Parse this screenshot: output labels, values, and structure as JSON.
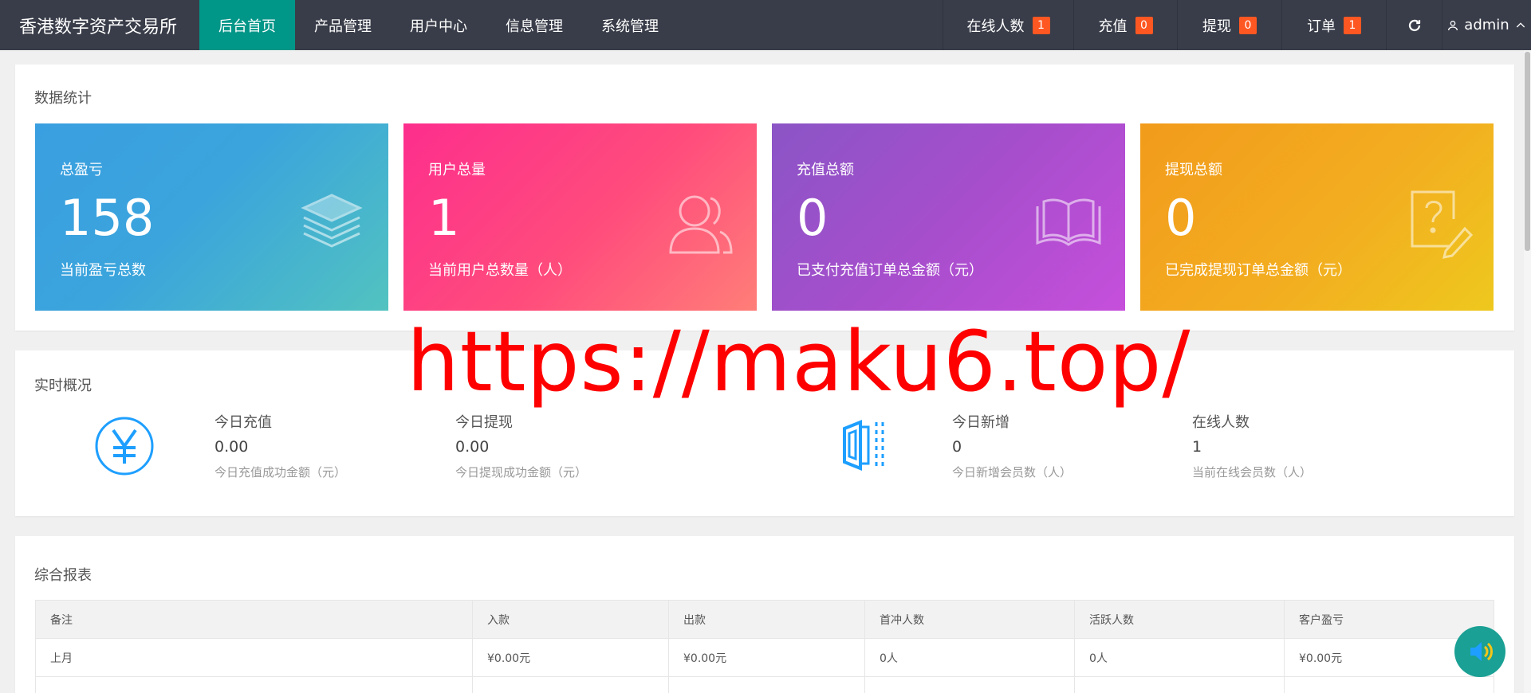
{
  "header": {
    "brand": "香港数字资产交易所",
    "nav": [
      {
        "label": "后台首页",
        "active": true
      },
      {
        "label": "产品管理"
      },
      {
        "label": "用户中心"
      },
      {
        "label": "信息管理"
      },
      {
        "label": "系统管理"
      }
    ],
    "right": {
      "online": {
        "label": "在线人数",
        "count": "1"
      },
      "recharge": {
        "label": "充值",
        "count": "0"
      },
      "withdraw": {
        "label": "提现",
        "count": "0"
      },
      "orders": {
        "label": "订单",
        "count": "1"
      },
      "refresh_icon": "refresh-icon",
      "user": "admin"
    }
  },
  "stats": {
    "title": "数据统计",
    "cards": [
      {
        "label": "总盈亏",
        "value": "158",
        "desc": "当前盈亏总数",
        "icon": "layers-icon"
      },
      {
        "label": "用户总量",
        "value": "1",
        "desc": "当前用户总数量（人）",
        "icon": "users-icon"
      },
      {
        "label": "充值总额",
        "value": "0",
        "desc": "已支付充值订单总金额（元）",
        "icon": "book-icon"
      },
      {
        "label": "提现总额",
        "value": "0",
        "desc": "已完成提现订单总金额（元）",
        "icon": "question-edit-icon"
      }
    ]
  },
  "realtime": {
    "title": "实时概况",
    "items": [
      {
        "title": "今日充值",
        "value": "0.00",
        "desc": "今日充值成功金额（元）"
      },
      {
        "title": "今日提现",
        "value": "0.00",
        "desc": "今日提现成功金额（元）"
      },
      {
        "title": "今日新增",
        "value": "0",
        "desc": "今日新增会员数（人）"
      },
      {
        "title": "在线人数",
        "value": "1",
        "desc": "当前在线会员数（人）"
      }
    ]
  },
  "watermark": "https://maku6.top/",
  "report": {
    "title": "综合报表",
    "columns": [
      "备注",
      "入款",
      "出款",
      "首冲人数",
      "活跃人数",
      "客户盈亏"
    ],
    "rows": [
      [
        "上月",
        "¥0.00元",
        "¥0.00元",
        "0人",
        "0人",
        "¥0.00元"
      ],
      [
        "",
        "",
        "",
        "",
        "",
        ""
      ]
    ]
  },
  "colors": {
    "header_bg": "#393d49",
    "accent": "#009688",
    "badge": "#ff5722"
  }
}
